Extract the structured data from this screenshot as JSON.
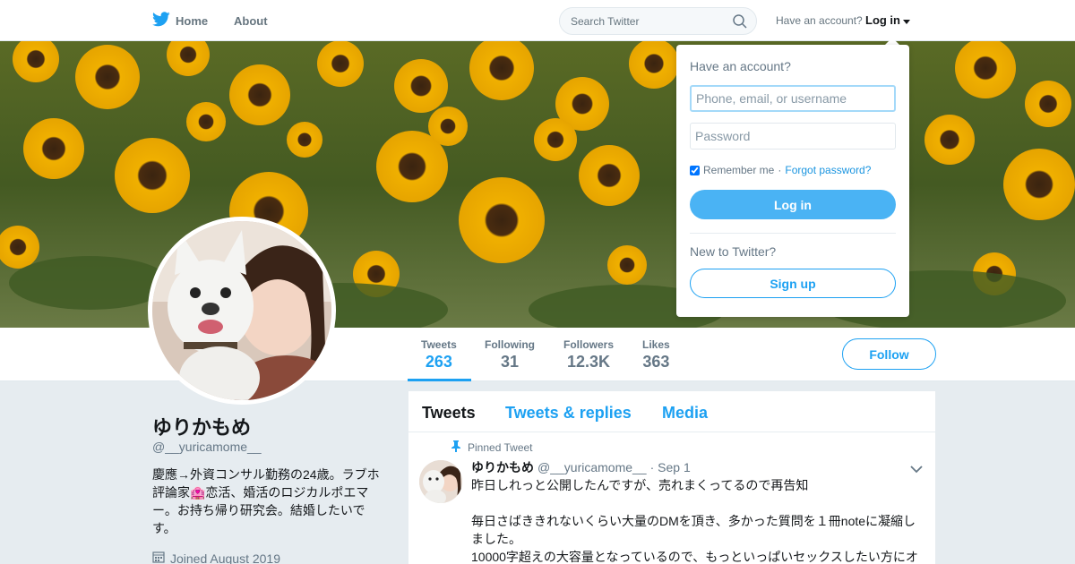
{
  "nav": {
    "home_label": "Home",
    "about_label": "About",
    "search_placeholder": "Search Twitter",
    "have_account_label": "Have an account?",
    "login_label": "Log in"
  },
  "profile": {
    "name": "ゆりかもめ",
    "handle": "@__yuricamome__",
    "bio": "慶應→外資コンサル勤務の24歳。ラブホ評論家🏩恋活、婚活のロジカルポエマー。お持ち帰り研究会。結婚したいです。",
    "joined": "Joined August 2019"
  },
  "stats": [
    {
      "label": "Tweets",
      "value": "263"
    },
    {
      "label": "Following",
      "value": "31"
    },
    {
      "label": "Followers",
      "value": "12.3K"
    },
    {
      "label": "Likes",
      "value": "363"
    }
  ],
  "follow_label": "Follow",
  "timeline": {
    "tabs": [
      "Tweets",
      "Tweets & replies",
      "Media"
    ],
    "pinned_label": "Pinned Tweet",
    "tweet": {
      "name": "ゆりかもめ",
      "handle": "@__yuricamome__",
      "date": "· Sep 1",
      "line1": "昨日しれっと公開したんですが、売れまくってるので再告知",
      "line2": "毎日さばききれないくらい大量のDMを頂き、多かった質問を１冊noteに凝縮しました。",
      "line3": "10000字超えの大容量となっているので、もっといっぱいセックスしたい方にオ"
    }
  },
  "login_dropdown": {
    "title": "Have an account?",
    "username_placeholder": "Phone, email, or username",
    "password_placeholder": "Password",
    "remember_label": "Remember me",
    "separator": "·",
    "forgot_label": "Forgot password?",
    "login_button": "Log in",
    "new_label": "New to Twitter?",
    "signup_button": "Sign up"
  },
  "colors": {
    "brand": "#1da1f2",
    "login_button": "#4ab3f4",
    "background": "#e6ecf0"
  },
  "icons": [
    "twitter-bird-icon",
    "search-icon",
    "caret-down-icon",
    "pin-icon",
    "chevron-down-icon",
    "calendar-icon"
  ]
}
